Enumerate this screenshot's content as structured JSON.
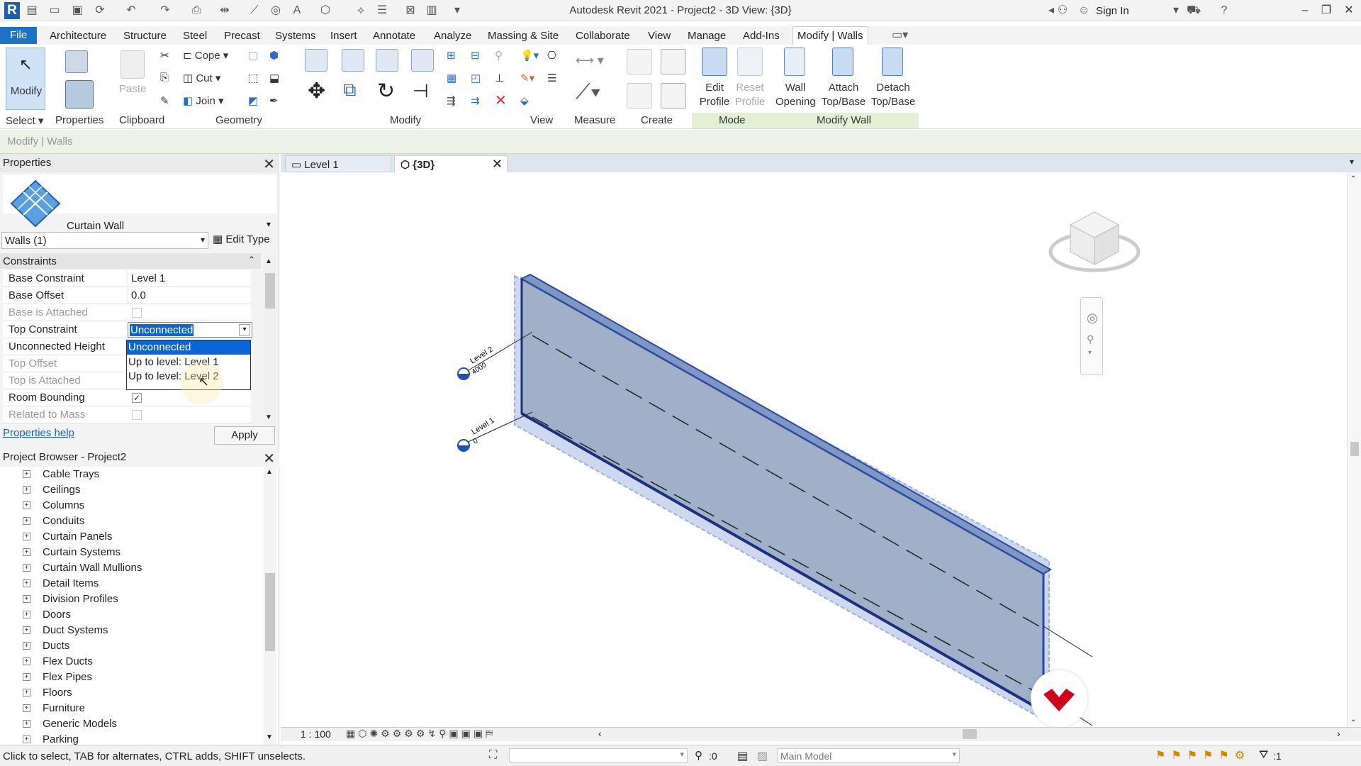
{
  "app": {
    "title": "Autodesk Revit 2021 - Project2 - 3D View: {3D}",
    "sign_in": "Sign In"
  },
  "menu": {
    "items": [
      "File",
      "Architecture",
      "Structure",
      "Steel",
      "Precast",
      "Systems",
      "Insert",
      "Annotate",
      "Analyze",
      "Massing & Site",
      "Collaborate",
      "View",
      "Manage",
      "Add-Ins",
      "Modify | Walls"
    ]
  },
  "ribbon": {
    "modify": "Modify",
    "paste": "Paste",
    "cope": "Cope",
    "cut": "Cut",
    "join": "Join",
    "edit_profile": [
      "Edit",
      "Profile"
    ],
    "reset_profile": [
      "Reset",
      "Profile"
    ],
    "wall_opening": [
      "Wall",
      "Opening"
    ],
    "attach": [
      "Attach",
      "Top/Base"
    ],
    "detach": [
      "Detach",
      "Top/Base"
    ],
    "panels": {
      "select": "Select",
      "properties": "Properties",
      "clipboard": "Clipboard",
      "geometry": "Geometry",
      "modify": "Modify",
      "view": "View",
      "measure": "Measure",
      "create": "Create",
      "mode": "Mode",
      "modify_wall": "Modify Wall"
    }
  },
  "context_label": "Modify | Walls",
  "properties": {
    "title": "Properties",
    "type_name": "Curtain Wall",
    "instance_filter": "Walls (1)",
    "edit_type": "Edit Type",
    "group": "Constraints",
    "rows": [
      {
        "key": "Base Constraint",
        "value": "Level 1"
      },
      {
        "key": "Base Offset",
        "value": "0.0"
      },
      {
        "key": "Base is Attached",
        "value": ""
      },
      {
        "key": "Top Constraint",
        "value": "Unconnected"
      },
      {
        "key": "Unconnected Height",
        "value": ""
      },
      {
        "key": "Top Offset",
        "value": ""
      },
      {
        "key": "Top is Attached",
        "value": ""
      },
      {
        "key": "Room Bounding",
        "value": ""
      },
      {
        "key": "Related to Mass",
        "value": ""
      }
    ],
    "dropdown_options": [
      "Unconnected",
      "Up to level: Level 1",
      "Up to level: Level 2"
    ],
    "help": "Properties help",
    "apply": "Apply"
  },
  "browser": {
    "title": "Project Browser - Project2",
    "items": [
      "Cable Trays",
      "Ceilings",
      "Columns",
      "Conduits",
      "Curtain Panels",
      "Curtain Systems",
      "Curtain Wall Mullions",
      "Detail Items",
      "Division Profiles",
      "Doors",
      "Duct Systems",
      "Ducts",
      "Flex Ducts",
      "Flex Pipes",
      "Floors",
      "Furniture",
      "Generic Models",
      "Parking"
    ]
  },
  "views": {
    "tabs": [
      "Level 1",
      "{3D}"
    ]
  },
  "levels": [
    {
      "name": "Level 2",
      "elev": "4000"
    },
    {
      "name": "Level 1",
      "elev": "0"
    }
  ],
  "viewbar": {
    "scale": "1 : 100"
  },
  "status": {
    "hint": "Click to select, TAB for alternates, CTRL adds, SHIFT unselects.",
    "count": ":0",
    "model": "Main Model",
    "filter": ":1"
  },
  "colors": {
    "accent": "#1a73c4",
    "wall": "#9fb0c8",
    "selection": "#2a5bd7"
  }
}
